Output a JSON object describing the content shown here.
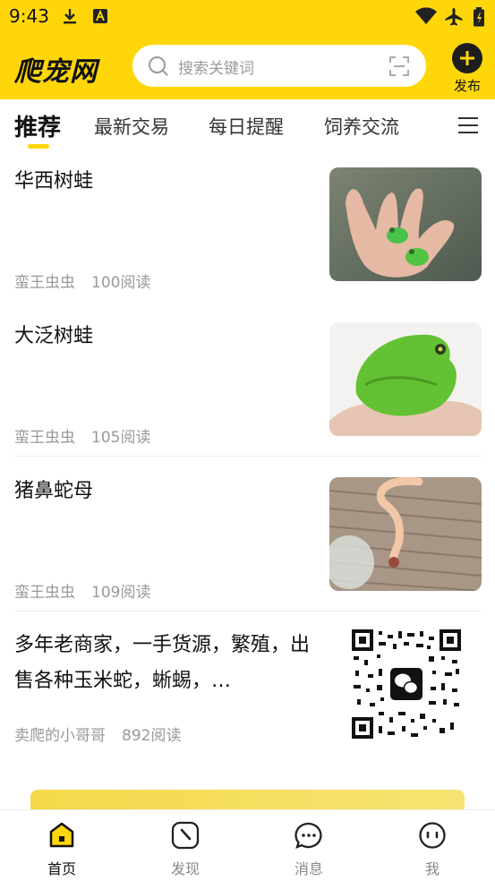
{
  "status_bar": {
    "time": "9:43",
    "icons": [
      "download-icon",
      "app-notification-icon",
      "wifi-icon",
      "airplane-icon",
      "battery-icon"
    ]
  },
  "header": {
    "logo_text": "爬宠网",
    "search_placeholder": "搜索关键词",
    "publish_label": "发布"
  },
  "tabs": [
    "推荐",
    "最新交易",
    "每日提醒",
    "饲养交流"
  ],
  "active_tab": 0,
  "feed": [
    {
      "title": "华西树蛙",
      "author": "蛮王虫虫",
      "reads": "100阅读",
      "thumb": "frog-in-hand"
    },
    {
      "title": "大泛树蛙",
      "author": "蛮王虫虫",
      "reads": "105阅读",
      "thumb": "green-frog"
    },
    {
      "title": "猪鼻蛇母",
      "author": "蛮王虫虫",
      "reads": "109阅读",
      "thumb": "snake"
    },
    {
      "title": "多年老商家，一手货源，繁殖，出售各种玉米蛇，蜥蜴，…",
      "author": "卖爬的小哥哥",
      "reads": "892阅读",
      "thumb": "qr-code"
    }
  ],
  "bottom_nav": [
    {
      "label": "首页",
      "icon": "home-icon",
      "active": true
    },
    {
      "label": "发现",
      "icon": "compass-icon",
      "active": false
    },
    {
      "label": "消息",
      "icon": "chat-bubble-icon",
      "active": false
    },
    {
      "label": "我",
      "icon": "profile-face-icon",
      "active": false
    }
  ],
  "colors": {
    "brand_yellow": "#FFD60A",
    "text_dark": "#111111",
    "text_muted": "#999999"
  }
}
